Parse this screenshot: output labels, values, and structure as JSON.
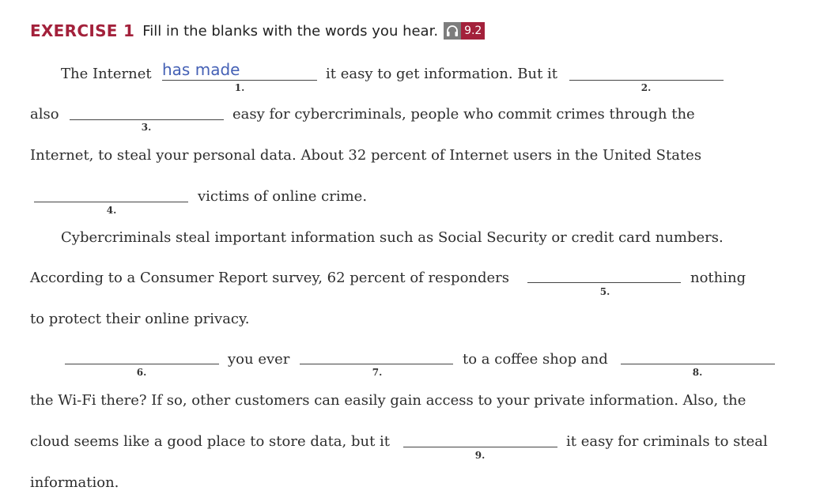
{
  "header": {
    "exercise_label": "EXERCISE 1",
    "instruction": "Fill in the blanks with the words you hear.",
    "audio_icon": "headphones-icon",
    "audio_track": "9.2"
  },
  "accent_color": "#a3213b",
  "answer_color": "#4561b5",
  "passage": {
    "seg1": "The Internet",
    "seg2": "it easy to get information. But it",
    "seg3": "also",
    "seg4": "easy for cybercriminals, people who commit crimes through the",
    "seg5": "Internet, to steal your personal data. About 32 percent of Internet users in the United States",
    "seg6": "victims of online crime.",
    "seg7": "Cybercriminals steal important information such as Social Security or credit card numbers.",
    "seg8": "According to a Consumer Report survey, 62 percent of responders",
    "seg9": "nothing",
    "seg10": "to protect their online privacy.",
    "seg11": "you ever",
    "seg12": "to a coffee shop and",
    "seg13": "the Wi-Fi there? If so, other customers can easily gain access to your private information. Also, the",
    "seg14": "cloud seems like a good place to store data, but it",
    "seg15": "it easy for criminals to steal",
    "seg16": "information."
  },
  "blanks": [
    {
      "number": "1.",
      "answer": "has made"
    },
    {
      "number": "2.",
      "answer": ""
    },
    {
      "number": "3.",
      "answer": ""
    },
    {
      "number": "4.",
      "answer": ""
    },
    {
      "number": "5.",
      "answer": ""
    },
    {
      "number": "6.",
      "answer": ""
    },
    {
      "number": "7.",
      "answer": ""
    },
    {
      "number": "8.",
      "answer": ""
    },
    {
      "number": "9.",
      "answer": ""
    }
  ]
}
